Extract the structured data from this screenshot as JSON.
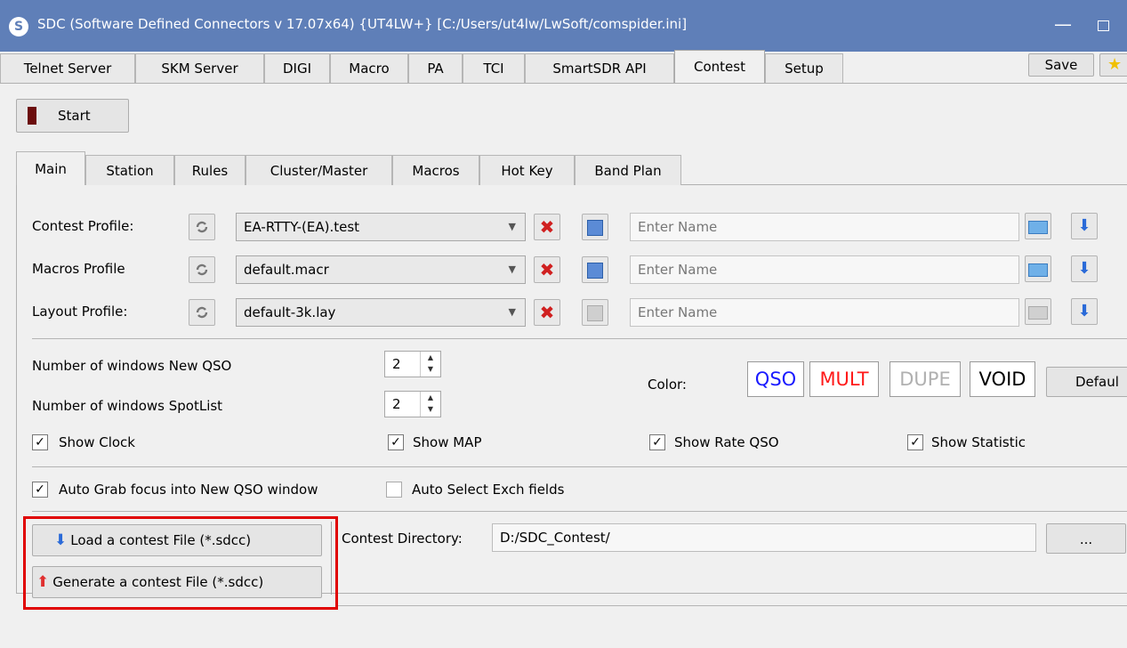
{
  "window": {
    "title": "SDC (Software Defined Connectors v 17.07x64) {UT4LW+} [C:/Users/ut4lw/LwSoft/comspider.ini]",
    "app_icon": "S",
    "minimize_glyph": "—"
  },
  "top_tabs": [
    "Telnet Server",
    "SKM Server",
    "DIGI",
    "Macro",
    "PA",
    "TCI",
    "SmartSDR API",
    "Contest",
    "Setup"
  ],
  "active_top_tab": "Contest",
  "toolbar": {
    "save_label": "Save",
    "star_glyph": "★",
    "start_label": "Start"
  },
  "inner_tabs": [
    "Main",
    "Station",
    "Rules",
    "Cluster/Master",
    "Macros",
    "Hot Key",
    "Band Plan"
  ],
  "active_inner_tab": "Main",
  "profiles": [
    {
      "label": "Contest Profile:",
      "value": "EA-RTTY-(EA).test",
      "placeholder": "Enter Name"
    },
    {
      "label": "Macros Profile",
      "value": "default.macr",
      "placeholder": "Enter Name"
    },
    {
      "label": "Layout Profile:",
      "value": "default-3k.lay",
      "placeholder": "Enter Name"
    }
  ],
  "windows": {
    "new_qso_label": "Number of windows New QSO",
    "new_qso_value": "2",
    "spotlist_label": "Number of windows SpotList",
    "spotlist_value": "2"
  },
  "color": {
    "label": "Color:",
    "qso": "QSO",
    "qso_color": "#1a1aff",
    "mult": "MULT",
    "mult_color": "#ff1a1a",
    "dupe": "DUPE",
    "dupe_color": "#b0b0b0",
    "void": "VOID",
    "void_color": "#000000",
    "default_label": "Defaul"
  },
  "checks": {
    "show_clock": "Show Clock",
    "show_map": "Show MAP",
    "show_rate": "Show Rate QSO",
    "show_statistic": "Show Statistic",
    "auto_grab": "Auto Grab focus into New QSO window",
    "auto_select": "Auto Select Exch fields",
    "checked_glyph": "✓"
  },
  "files": {
    "load_label": "Load a contest File (*.sdcc)",
    "generate_label": "Generate a contest File (*.sdcc)",
    "dir_label": "Contest Directory:",
    "dir_value": "D:/SDC_Contest/",
    "browse_label": "..."
  }
}
